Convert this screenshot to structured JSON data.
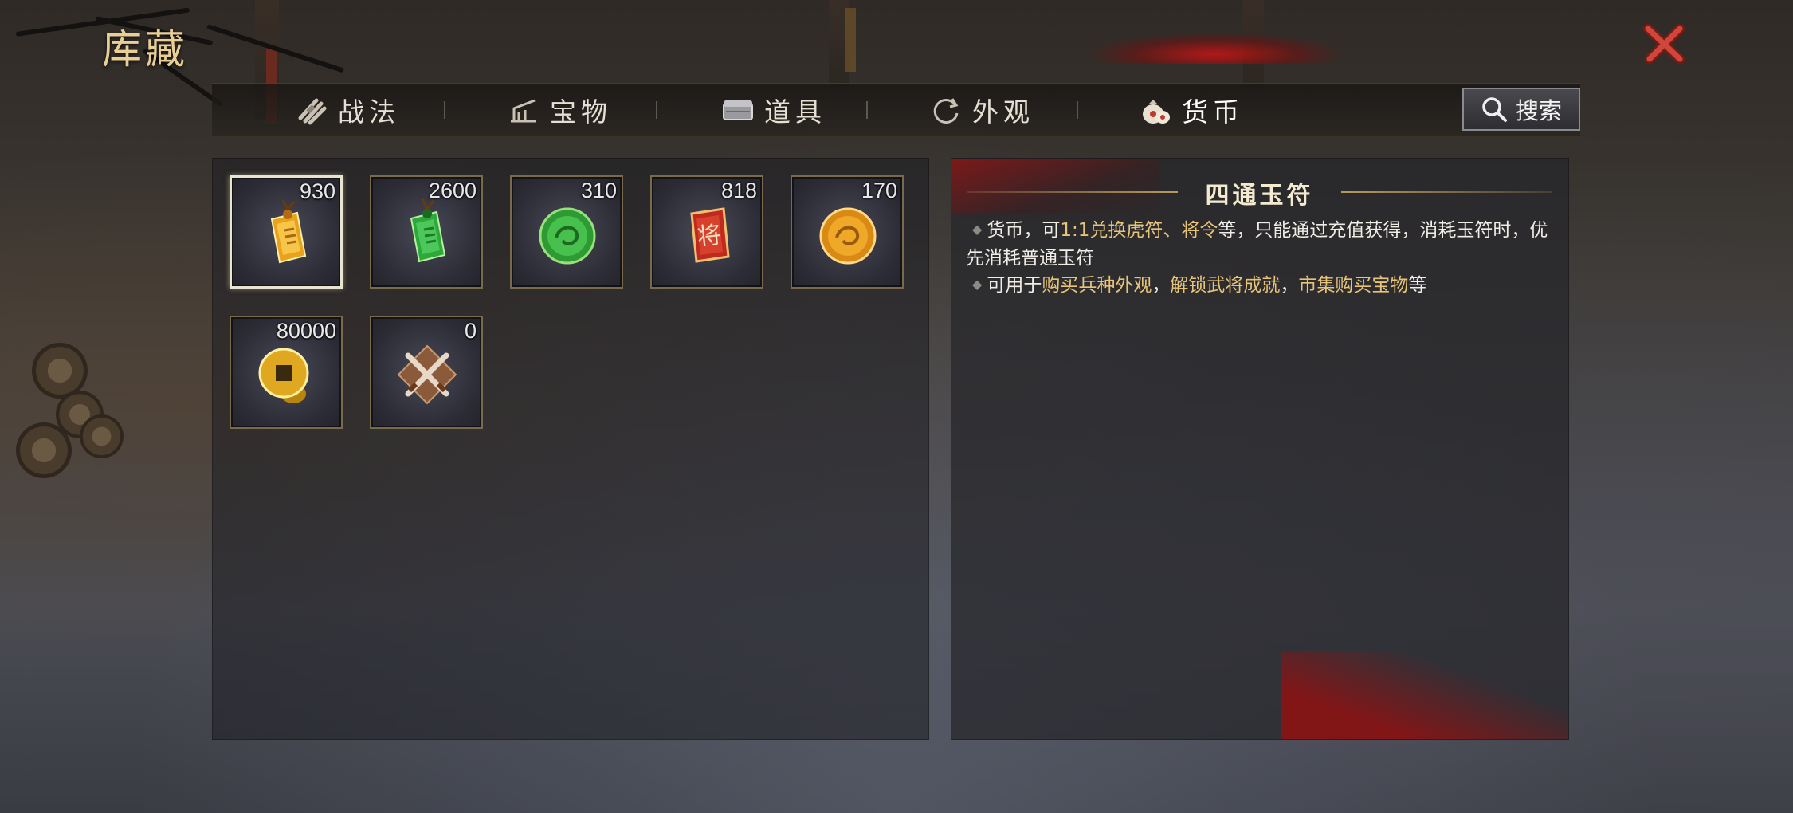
{
  "window": {
    "title": "库藏"
  },
  "tabs": [
    {
      "label": "战法",
      "icon": "scroll-bundle-icon"
    },
    {
      "label": "宝物",
      "icon": "treasure-icon"
    },
    {
      "label": "道具",
      "icon": "chest-icon"
    },
    {
      "label": "外观",
      "icon": "refresh-swirl-icon"
    },
    {
      "label": "货币",
      "icon": "money-bag-icon",
      "active": true
    }
  ],
  "search": {
    "label": "搜索",
    "icon": "search-icon"
  },
  "items": [
    {
      "name": "gold-jade-tally",
      "count": "930",
      "selected": true
    },
    {
      "name": "green-jade-tally",
      "count": "2600"
    },
    {
      "name": "green-jade-coin",
      "count": "310"
    },
    {
      "name": "general-order-token",
      "count": "818"
    },
    {
      "name": "gold-dragon-coin",
      "count": "170"
    },
    {
      "name": "copper-coin",
      "count": "80000"
    },
    {
      "name": "crossed-swords-token",
      "count": "0"
    }
  ],
  "detail": {
    "title": "四通玉符",
    "line1_a": "货币，可",
    "line1_b": "1:1兑换虎符、将令",
    "line1_c": "等，只能通过充值获得，消耗玉符时，优先消耗普通玉符",
    "line2_a": "可用于",
    "line2_b": "购买兵种外观",
    "line2_c": "，",
    "line2_d": "解锁武将成就",
    "line2_e": "，",
    "line2_f": "市集购买宝物",
    "line2_g": "等"
  },
  "colors": {
    "gold_title": "#e9cf96",
    "highlight": "#e7c47a",
    "close_red": "#c0392b",
    "active_tab_glow": "#c81414"
  }
}
